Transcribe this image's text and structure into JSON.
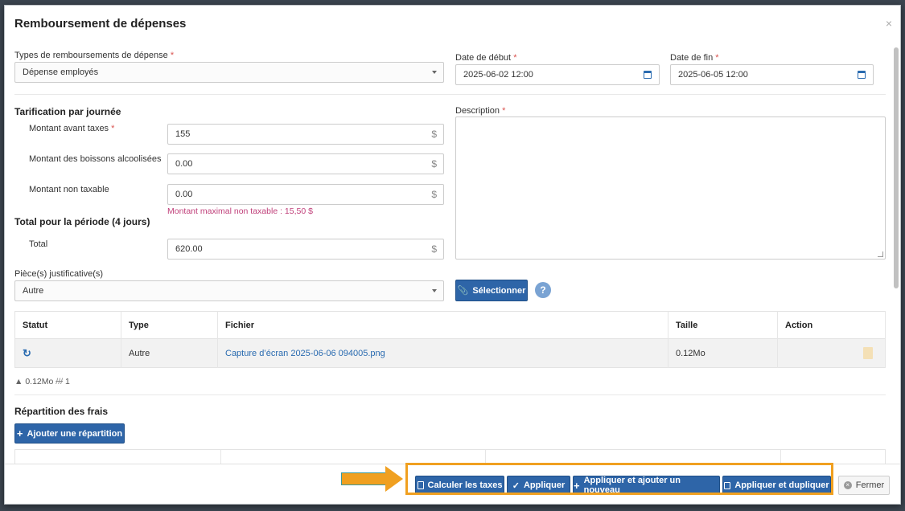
{
  "modal": {
    "title": "Remboursement de dépenses",
    "close": "×"
  },
  "form": {
    "type_label": "Types de remboursements de dépense",
    "type_value": "Dépense employés",
    "start_label": "Date de début",
    "start_value": "2025-06-02 12:00",
    "end_label": "Date de fin",
    "end_value": "2025-06-05 12:00",
    "required_mark": "*",
    "pricing_section": "Tarification par journée",
    "amount_label": "Montant avant taxes",
    "amount_value": "155",
    "alcohol_label": "Montant des boissons alcoolisées",
    "alcohol_value": "0.00",
    "nontax_label": "Montant non taxable",
    "nontax_value": "0.00",
    "nontax_hint": "Montant maximal non taxable : 15,50 $",
    "currency": "$",
    "total_section": "Total pour la période (4 jours)",
    "total_label": "Total",
    "total_value": "620.00",
    "description_label": "Description",
    "attachments_label": "Pièce(s) justificative(s)",
    "attachments_value": "Autre",
    "select_button": "Sélectionner",
    "help": "?"
  },
  "files_table": {
    "headers": [
      "Statut",
      "Type",
      "Fichier",
      "Taille",
      "Action"
    ],
    "rows": [
      {
        "type": "Autre",
        "file": "Capture d’écran 2025-06-06 094005.png",
        "size": "0.12Mo"
      }
    ],
    "summary_size": "0.12Mo",
    "summary_count": "1"
  },
  "allocation": {
    "section": "Répartition des frais",
    "add_button": "Ajouter une répartition"
  },
  "footer": {
    "calc_taxes": "Calculer les taxes",
    "apply": "Appliquer",
    "apply_new": "Appliquer et ajouter un nouveau",
    "apply_duplicate": "Appliquer et dupliquer",
    "close": "Fermer"
  },
  "colors": {
    "primary": "#2e65a8",
    "highlight": "#f0a020",
    "hint": "#c0407a"
  }
}
